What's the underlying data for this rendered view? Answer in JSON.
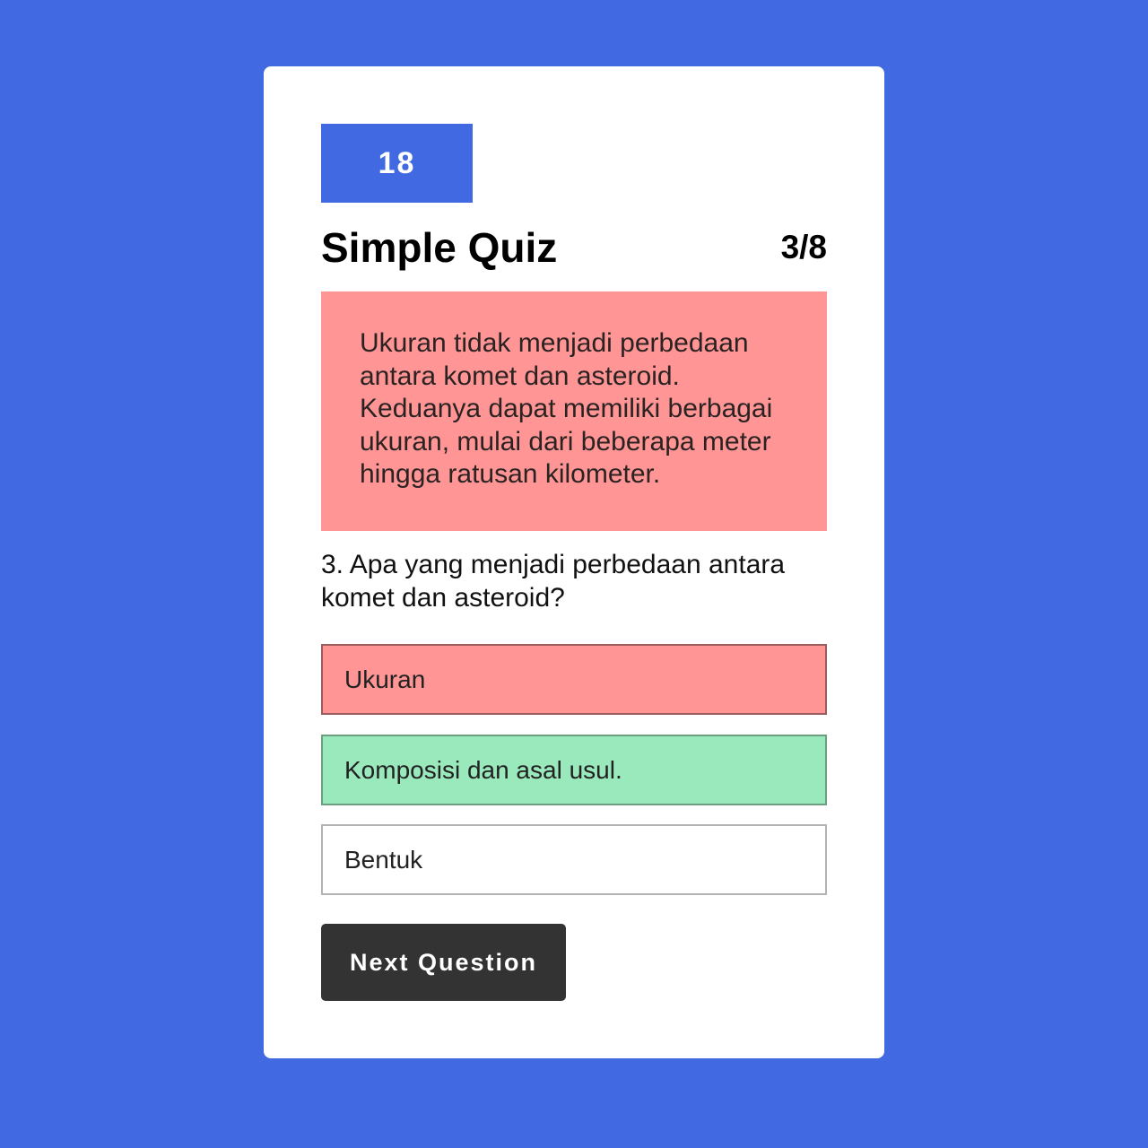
{
  "timer": {
    "value": "18"
  },
  "quiz": {
    "title": "Simple Quiz",
    "progress": "3/8"
  },
  "feedback": {
    "text": "Ukuran tidak menjadi perbedaan antara komet dan asteroid. Keduanya dapat memiliki berbagai ukuran, mulai dari beberapa meter hingga ratusan kilometer."
  },
  "question": {
    "text": "3. Apa yang menjadi perbedaan antara komet dan asteroid?"
  },
  "answers": [
    {
      "label": "Ukuran",
      "state": "wrong"
    },
    {
      "label": "Komposisi dan asal usul.",
      "state": "correct"
    },
    {
      "label": "Bentuk",
      "state": "neutral"
    }
  ],
  "next_button": {
    "label": "Next Question"
  },
  "colors": {
    "background": "#4169e1",
    "timer_bg": "#4169e1",
    "wrong": "#ff9595",
    "correct": "#9ae9bc",
    "button": "#333333"
  }
}
